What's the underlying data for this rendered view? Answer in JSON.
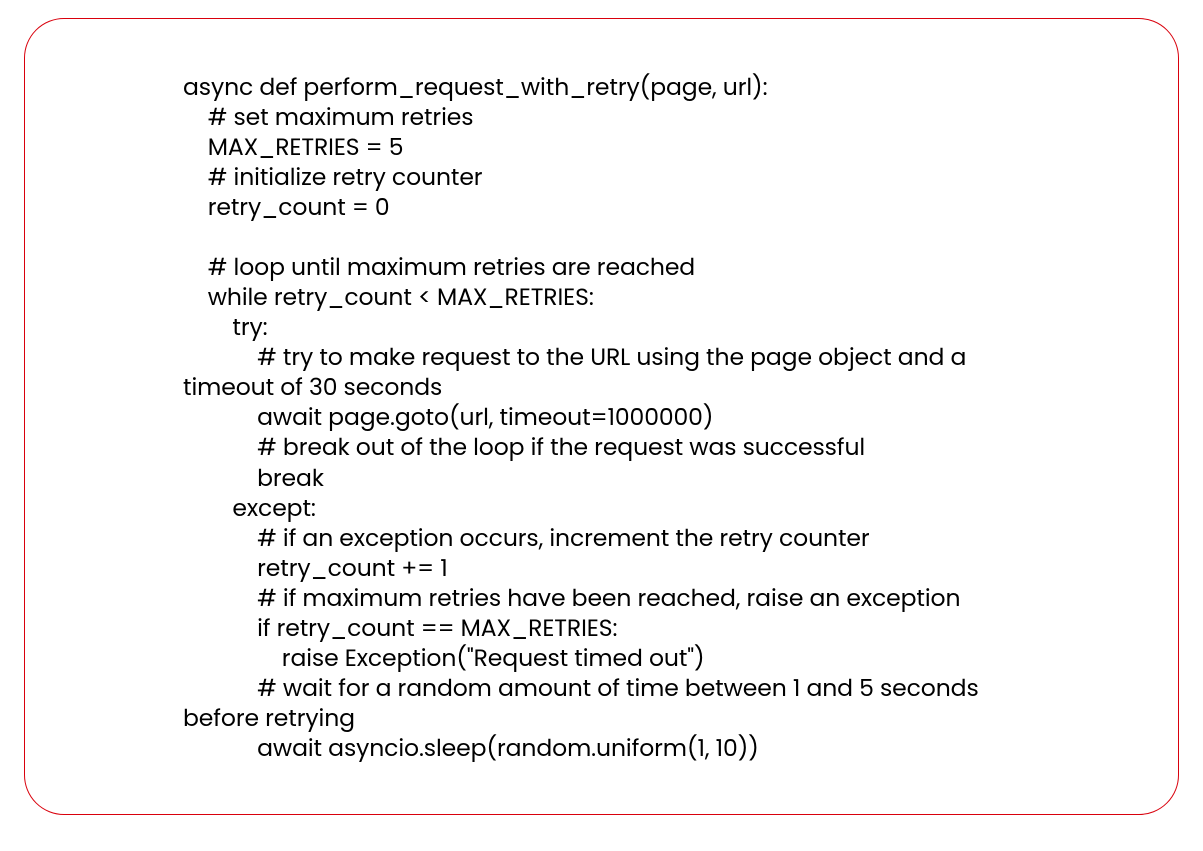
{
  "code": {
    "lines": [
      "async def perform_request_with_retry(page, url):",
      "    # set maximum retries",
      "    MAX_RETRIES = 5",
      "    # initialize retry counter",
      "    retry_count = 0",
      "",
      "    # loop until maximum retries are reached",
      "    while retry_count < MAX_RETRIES:",
      "        try:",
      "            # try to make request to the URL using the page object and a timeout of 30 seconds",
      "            await page.goto(url, timeout=1000000)",
      "            # break out of the loop if the request was successful",
      "            break",
      "        except:",
      "            # if an exception occurs, increment the retry counter",
      "            retry_count += 1",
      "            # if maximum retries have been reached, raise an exception",
      "            if retry_count == MAX_RETRIES:",
      "                raise Exception(\"Request timed out\")",
      "            # wait for a random amount of time between 1 and 5 seconds before retrying",
      "            await asyncio.sleep(random.uniform(1, 10))"
    ]
  }
}
